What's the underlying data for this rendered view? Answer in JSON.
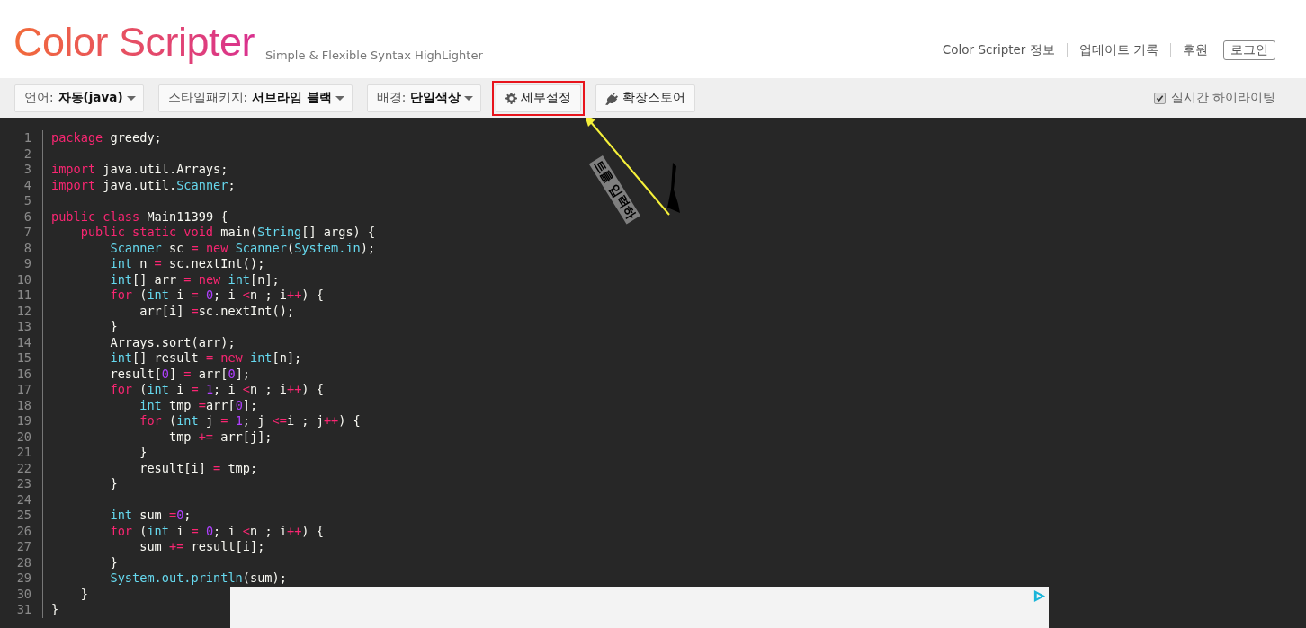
{
  "header": {
    "logo": "Color Scripter",
    "tagline": "Simple & Flexible Syntax HighLighter",
    "nav": [
      "Color Scripter 정보",
      "업데이트 기록",
      "후원"
    ],
    "login": "로그인"
  },
  "toolbar": {
    "selects": [
      {
        "label": "언어:",
        "value": "자동(java)"
      },
      {
        "label": "스타일패키지:",
        "value": "서브라임 블랙"
      },
      {
        "label": "배경:",
        "value": "단일색상"
      }
    ],
    "buttons": [
      {
        "kind": "gear",
        "label": "세부설정",
        "highlighted": true
      },
      {
        "kind": "plug",
        "label": "확장스토어",
        "highlighted": false
      }
    ],
    "checkbox": {
      "label": "실시간 하이라이팅",
      "checked": true
    }
  },
  "annotation": {
    "text": "트를 입력하"
  },
  "code": [
    {
      "n": "1",
      "tokens": [
        {
          "kind": "kw",
          "t": "package"
        },
        {
          "kind": "p",
          "t": " greedy;"
        }
      ]
    },
    {
      "n": "2"
    },
    {
      "n": "3",
      "tokens": [
        {
          "kind": "kw",
          "t": "import"
        },
        {
          "kind": "p",
          "t": " java.util.Arrays;"
        }
      ]
    },
    {
      "n": "4",
      "tokens": [
        {
          "kind": "kw",
          "t": "import"
        },
        {
          "kind": "p",
          "t": " java.util."
        },
        {
          "kind": "ty",
          "t": "Scanner"
        },
        {
          "kind": "p",
          "t": ";"
        }
      ]
    },
    {
      "n": "5"
    },
    {
      "n": "6",
      "tokens": [
        {
          "kind": "kw",
          "t": "public class"
        },
        {
          "kind": "p",
          "t": " Main11399 {"
        }
      ]
    },
    {
      "n": "7",
      "tokens": [
        {
          "kind": "kw",
          "t": "    public static void"
        },
        {
          "kind": "p",
          "t": " main("
        },
        {
          "kind": "ty",
          "t": "String"
        },
        {
          "kind": "p",
          "t": "[] args) {"
        }
      ]
    },
    {
      "n": "8",
      "tokens": [
        {
          "kind": "ty",
          "t": "        Scanner"
        },
        {
          "kind": "p",
          "t": " sc "
        },
        {
          "kind": "op",
          "t": "="
        },
        {
          "kind": "kw",
          "t": " new"
        },
        {
          "kind": "ty",
          "t": " Scanner"
        },
        {
          "kind": "p",
          "t": "("
        },
        {
          "kind": "ty",
          "t": "System.in"
        },
        {
          "kind": "p",
          "t": ");"
        }
      ]
    },
    {
      "n": "9",
      "tokens": [
        {
          "kind": "ty",
          "t": "        int"
        },
        {
          "kind": "p",
          "t": " n "
        },
        {
          "kind": "op",
          "t": "="
        },
        {
          "kind": "p",
          "t": " sc.nextInt();"
        }
      ]
    },
    {
      "n": "10",
      "tokens": [
        {
          "kind": "ty",
          "t": "        int"
        },
        {
          "kind": "p",
          "t": "[] arr "
        },
        {
          "kind": "op",
          "t": "="
        },
        {
          "kind": "kw",
          "t": " new"
        },
        {
          "kind": "ty",
          "t": " int"
        },
        {
          "kind": "p",
          "t": "[n];"
        }
      ]
    },
    {
      "n": "11",
      "tokens": [
        {
          "kind": "kw",
          "t": "        for"
        },
        {
          "kind": "p",
          "t": " ("
        },
        {
          "kind": "ty",
          "t": "int"
        },
        {
          "kind": "p",
          "t": " i "
        },
        {
          "kind": "op",
          "t": "="
        },
        {
          "kind": "num",
          "t": " 0"
        },
        {
          "kind": "p",
          "t": "; i "
        },
        {
          "kind": "op",
          "t": "<"
        },
        {
          "kind": "p",
          "t": "n ; i"
        },
        {
          "kind": "op",
          "t": "++"
        },
        {
          "kind": "p",
          "t": ") {"
        }
      ]
    },
    {
      "n": "12",
      "tokens": [
        {
          "kind": "p",
          "t": "            arr[i] "
        },
        {
          "kind": "op",
          "t": "="
        },
        {
          "kind": "p",
          "t": "sc.nextInt();"
        }
      ]
    },
    {
      "n": "13",
      "tokens": [
        {
          "kind": "p",
          "t": "        }"
        }
      ]
    },
    {
      "n": "14",
      "tokens": [
        {
          "kind": "p",
          "t": "        Arrays.sort(arr);"
        }
      ]
    },
    {
      "n": "15",
      "tokens": [
        {
          "kind": "ty",
          "t": "        int"
        },
        {
          "kind": "p",
          "t": "[] result "
        },
        {
          "kind": "op",
          "t": "="
        },
        {
          "kind": "kw",
          "t": " new"
        },
        {
          "kind": "ty",
          "t": " int"
        },
        {
          "kind": "p",
          "t": "[n];"
        }
      ]
    },
    {
      "n": "16",
      "tokens": [
        {
          "kind": "p",
          "t": "        result["
        },
        {
          "kind": "num",
          "t": "0"
        },
        {
          "kind": "p",
          "t": "] "
        },
        {
          "kind": "op",
          "t": "="
        },
        {
          "kind": "p",
          "t": " arr["
        },
        {
          "kind": "num",
          "t": "0"
        },
        {
          "kind": "p",
          "t": "];"
        }
      ]
    },
    {
      "n": "17",
      "tokens": [
        {
          "kind": "kw",
          "t": "        for"
        },
        {
          "kind": "p",
          "t": " ("
        },
        {
          "kind": "ty",
          "t": "int"
        },
        {
          "kind": "p",
          "t": " i "
        },
        {
          "kind": "op",
          "t": "="
        },
        {
          "kind": "num",
          "t": " 1"
        },
        {
          "kind": "p",
          "t": "; i "
        },
        {
          "kind": "op",
          "t": "<"
        },
        {
          "kind": "p",
          "t": "n ; i"
        },
        {
          "kind": "op",
          "t": "++"
        },
        {
          "kind": "p",
          "t": ") {"
        }
      ]
    },
    {
      "n": "18",
      "tokens": [
        {
          "kind": "ty",
          "t": "            int"
        },
        {
          "kind": "p",
          "t": " tmp "
        },
        {
          "kind": "op",
          "t": "="
        },
        {
          "kind": "p",
          "t": "arr["
        },
        {
          "kind": "num",
          "t": "0"
        },
        {
          "kind": "p",
          "t": "];"
        }
      ]
    },
    {
      "n": "19",
      "tokens": [
        {
          "kind": "kw",
          "t": "            for"
        },
        {
          "kind": "p",
          "t": " ("
        },
        {
          "kind": "ty",
          "t": "int"
        },
        {
          "kind": "p",
          "t": " j "
        },
        {
          "kind": "op",
          "t": "="
        },
        {
          "kind": "num",
          "t": " 1"
        },
        {
          "kind": "p",
          "t": "; j "
        },
        {
          "kind": "op",
          "t": "<="
        },
        {
          "kind": "p",
          "t": "i ; j"
        },
        {
          "kind": "op",
          "t": "++"
        },
        {
          "kind": "p",
          "t": ") {"
        }
      ]
    },
    {
      "n": "20",
      "tokens": [
        {
          "kind": "p",
          "t": "                tmp "
        },
        {
          "kind": "op",
          "t": "+="
        },
        {
          "kind": "p",
          "t": " arr[j];"
        }
      ]
    },
    {
      "n": "21",
      "tokens": [
        {
          "kind": "p",
          "t": "            }"
        }
      ]
    },
    {
      "n": "22",
      "tokens": [
        {
          "kind": "p",
          "t": "            result[i] "
        },
        {
          "kind": "op",
          "t": "="
        },
        {
          "kind": "p",
          "t": " tmp;"
        }
      ]
    },
    {
      "n": "23",
      "tokens": [
        {
          "kind": "p",
          "t": "        }"
        }
      ]
    },
    {
      "n": "24"
    },
    {
      "n": "25",
      "tokens": [
        {
          "kind": "ty",
          "t": "        int"
        },
        {
          "kind": "p",
          "t": " sum "
        },
        {
          "kind": "op",
          "t": "="
        },
        {
          "kind": "num",
          "t": "0"
        },
        {
          "kind": "p",
          "t": ";"
        }
      ]
    },
    {
      "n": "26",
      "tokens": [
        {
          "kind": "kw",
          "t": "        for"
        },
        {
          "kind": "p",
          "t": " ("
        },
        {
          "kind": "ty",
          "t": "int"
        },
        {
          "kind": "p",
          "t": " i "
        },
        {
          "kind": "op",
          "t": "="
        },
        {
          "kind": "num",
          "t": " 0"
        },
        {
          "kind": "p",
          "t": "; i "
        },
        {
          "kind": "op",
          "t": "<"
        },
        {
          "kind": "p",
          "t": "n ; i"
        },
        {
          "kind": "op",
          "t": "++"
        },
        {
          "kind": "p",
          "t": ") {"
        }
      ]
    },
    {
      "n": "27",
      "tokens": [
        {
          "kind": "p",
          "t": "            sum "
        },
        {
          "kind": "op",
          "t": "+="
        },
        {
          "kind": "p",
          "t": " result[i];"
        }
      ]
    },
    {
      "n": "28",
      "tokens": [
        {
          "kind": "p",
          "t": "        }"
        }
      ]
    },
    {
      "n": "29",
      "tokens": [
        {
          "kind": "ty",
          "t": "        System.out.println"
        },
        {
          "kind": "p",
          "t": "(sum);"
        }
      ]
    },
    {
      "n": "30",
      "tokens": [
        {
          "kind": "p",
          "t": "    }"
        }
      ]
    },
    {
      "n": "31",
      "tokens": [
        {
          "kind": "p",
          "t": "}"
        }
      ]
    }
  ],
  "ad": {
    "kind": "ad"
  }
}
